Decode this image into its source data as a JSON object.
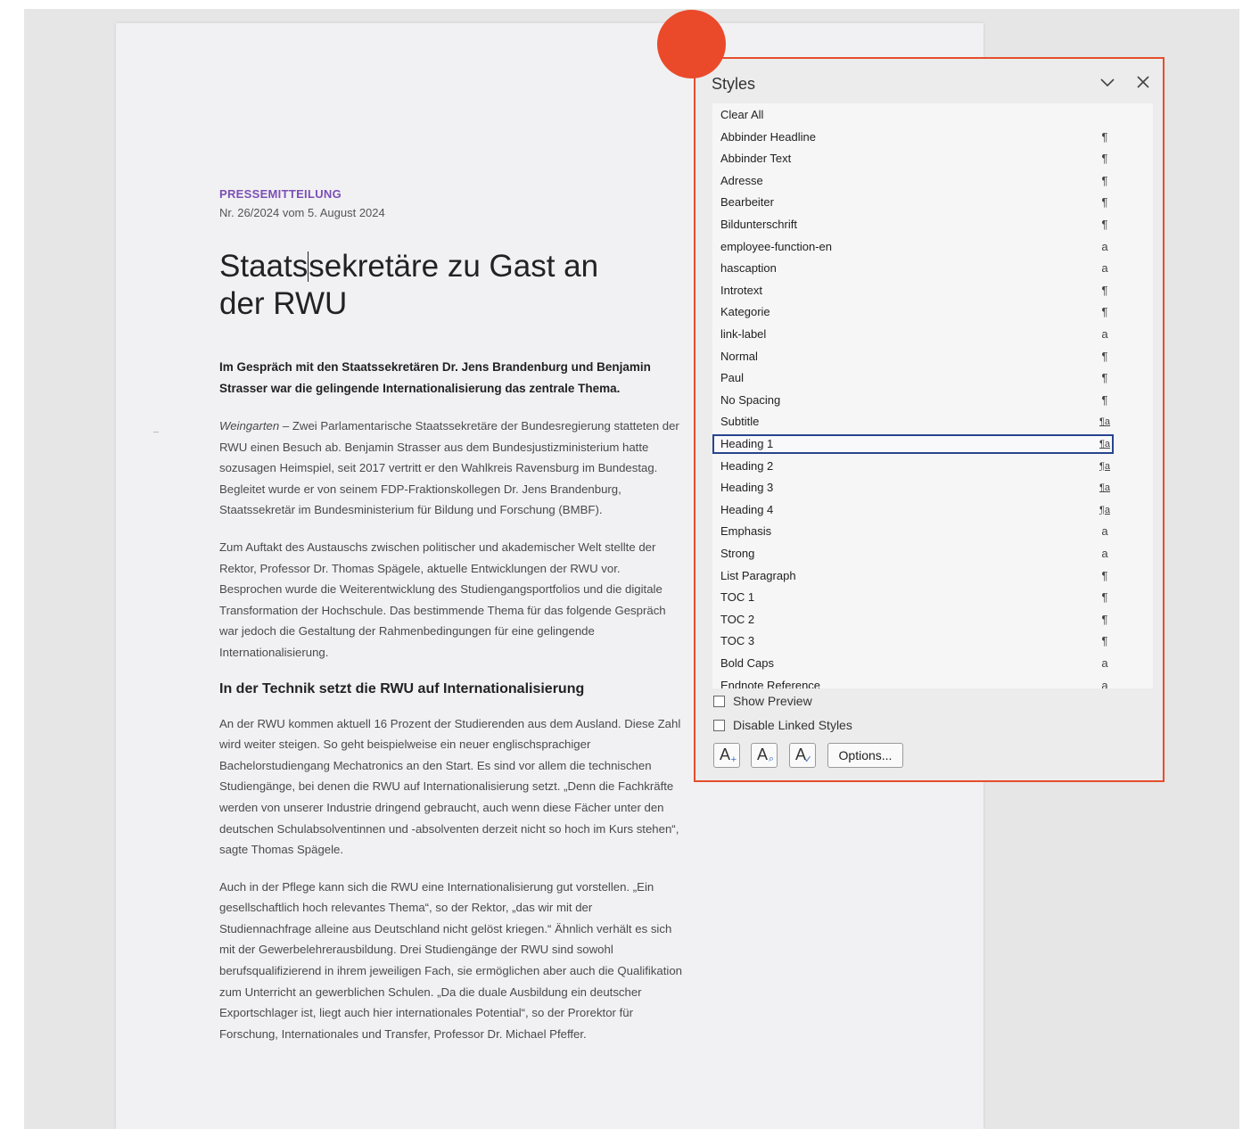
{
  "document": {
    "kicker": "PRESSEMITTEILUNG",
    "issue": "Nr. 26/2024 vom 5. August 2024",
    "title_part1": "Staats",
    "title_part2": "sekretäre zu Gast an der RWU",
    "lead": "Im Gespräch mit den Staatssekretären Dr. Jens Brandenburg und Benjamin Strasser war die gelingende Internationalisierung das zentrale Thema.",
    "p1_place": "Weingarten",
    "p1_text": " – Zwei Parlamentarische Staatssekretäre der Bundesregierung statteten der RWU einen Besuch ab. Benjamin Strasser aus dem Bundesjustizministerium hatte sozusagen Heimspiel, seit 2017 vertritt er den Wahlkreis Ravensburg im Bundestag. Begleitet wurde er von seinem FDP-Fraktionskollegen Dr. Jens Brandenburg, Staatssekretär im Bundesministerium für Bildung und Forschung (BMBF).",
    "p2": "Zum Auftakt des Austauschs zwischen politischer und akademischer Welt stellte der Rektor, Professor Dr. Thomas Spägele, aktuelle Entwicklungen der RWU vor. Besprochen wurde die Weiterentwicklung des Studiengangsportfolios und die digitale Transformation der Hochschule. Das bestimmende Thema für das folgende Gespräch war jedoch die Gestaltung der Rahmenbedingungen für eine gelingende Internationalisierung.",
    "subhead": "In der Technik setzt die RWU auf Internationalisierung",
    "p3": "An der RWU kommen aktuell 16 Prozent der Studierenden aus dem Ausland. Diese Zahl wird weiter steigen. So geht beispielweise ein neuer englischsprachiger Bachelorstudiengang Mechatronics an den Start. Es sind vor allem die technischen Studiengänge, bei denen die RWU auf Internationalisierung setzt. „Denn die Fachkräfte werden von unserer Industrie dringend gebraucht, auch wenn diese Fächer unter den deutschen Schulabsolventinnen und -absolventen derzeit nicht so hoch im Kurs stehen“, sagte Thomas Spägele.",
    "p4": "Auch in der Pflege kann sich die RWU eine Internationalisierung gut vorstellen. „Ein gesellschaftlich hoch relevantes Thema“, so der Rektor, „das wir mit der Studiennachfrage alleine aus Deutschland nicht gelöst kriegen.“ Ähnlich verhält es sich mit der Gewerbelehrerausbildung. Drei Studiengänge der RWU sind sowohl berufsqualifizierend in ihrem jeweiligen Fach, sie ermöglichen aber auch die Qualifikation zum Unterricht an gewerblichen Schulen. „Da die duale Ausbildung ein deutscher Exportschlager ist, liegt auch hier internationales Potential“, so der Prorektor für Forschung, Internationales und Transfer, Professor Dr. Michael Pfeffer."
  },
  "styles_pane": {
    "title": "Styles",
    "items": [
      {
        "label": "Clear All",
        "type": ""
      },
      {
        "label": "Abbinder Headline",
        "type": "¶"
      },
      {
        "label": "Abbinder Text",
        "type": "¶"
      },
      {
        "label": "Adresse",
        "type": "¶"
      },
      {
        "label": "Bearbeiter",
        "type": "¶"
      },
      {
        "label": "Bildunterschrift",
        "type": "¶"
      },
      {
        "label": "employee-function-en",
        "type": "a"
      },
      {
        "label": "hascaption",
        "type": "a"
      },
      {
        "label": "Introtext",
        "type": "¶"
      },
      {
        "label": "Kategorie",
        "type": "¶"
      },
      {
        "label": "link-label",
        "type": "a"
      },
      {
        "label": "Normal",
        "type": "¶"
      },
      {
        "label": "Paul",
        "type": "¶"
      },
      {
        "label": "No Spacing",
        "type": "¶"
      },
      {
        "label": "Subtitle",
        "type": "¶a"
      },
      {
        "label": "Heading 1",
        "type": "¶a"
      },
      {
        "label": "Heading 2",
        "type": "¶a"
      },
      {
        "label": "Heading 3",
        "type": "¶a"
      },
      {
        "label": "Heading 4",
        "type": "¶a"
      },
      {
        "label": "Emphasis",
        "type": "a"
      },
      {
        "label": "Strong",
        "type": "a"
      },
      {
        "label": "List Paragraph",
        "type": "¶"
      },
      {
        "label": "TOC 1",
        "type": "¶"
      },
      {
        "label": "TOC 2",
        "type": "¶"
      },
      {
        "label": "TOC 3",
        "type": "¶"
      },
      {
        "label": "Bold Caps",
        "type": "a"
      },
      {
        "label": "Endnote Reference",
        "type": "a"
      }
    ],
    "selected_item": "Heading 1",
    "show_preview_label": "Show Preview",
    "disable_linked_label": "Disable Linked Styles",
    "options_label": "Options...",
    "new_style_glyph": "A",
    "new_style_mark": "+",
    "style_inspector_glyph": "A",
    "style_inspector_mark": "⌕",
    "manage_styles_glyph": "A",
    "manage_styles_mark": "✓"
  },
  "icons": {
    "chevron": "chevron-down-icon",
    "close": "close-icon",
    "highlight": "red-dot-marker"
  },
  "colors": {
    "highlight": "#e54e2c",
    "kicker": "#7b4fb5",
    "selection_border": "#27458c"
  }
}
